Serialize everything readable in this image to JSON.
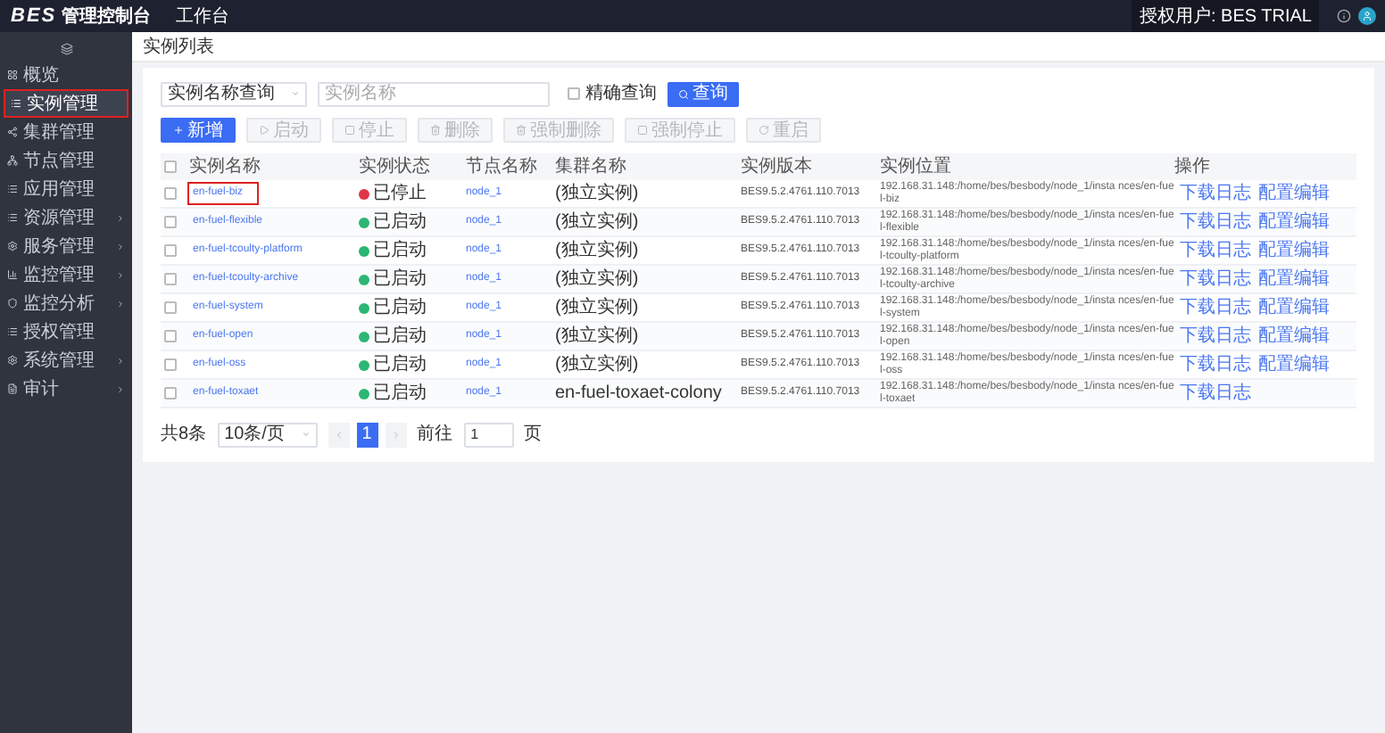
{
  "header": {
    "logo": "BES",
    "title": "管理控制台",
    "nav": "工作台",
    "user": "授权用户: BES TRIAL"
  },
  "sidebar": {
    "items": [
      {
        "label": "概览",
        "expandable": false,
        "selected": false
      },
      {
        "label": "实例管理",
        "expandable": false,
        "selected": true
      },
      {
        "label": "集群管理",
        "expandable": false,
        "selected": false
      },
      {
        "label": "节点管理",
        "expandable": false,
        "selected": false
      },
      {
        "label": "应用管理",
        "expandable": false,
        "selected": false
      },
      {
        "label": "资源管理",
        "expandable": true,
        "selected": false
      },
      {
        "label": "服务管理",
        "expandable": true,
        "selected": false
      },
      {
        "label": "监控管理",
        "expandable": true,
        "selected": false
      },
      {
        "label": "监控分析",
        "expandable": true,
        "selected": false
      },
      {
        "label": "授权管理",
        "expandable": false,
        "selected": false
      },
      {
        "label": "系统管理",
        "expandable": true,
        "selected": false
      },
      {
        "label": "审计",
        "expandable": true,
        "selected": false
      }
    ]
  },
  "breadcrumb": "实例列表",
  "filters": {
    "select": "实例名称查询",
    "search": {
      "placeholder": "实例名称"
    },
    "exact": {
      "label": "精确查询",
      "checked": false
    },
    "query": "查询"
  },
  "toolbar": [
    {
      "label": "新增",
      "disabled": false
    },
    {
      "label": "启动",
      "disabled": true
    },
    {
      "label": "停止",
      "disabled": true
    },
    {
      "label": "删除",
      "disabled": true
    },
    {
      "label": "强制删除",
      "disabled": true
    },
    {
      "label": "强制停止",
      "disabled": true
    },
    {
      "label": "重启",
      "disabled": true
    }
  ],
  "table": {
    "all_checked": false,
    "columns": [
      "实例名称",
      "实例状态",
      "节点名称",
      "集群名称",
      "实例版本",
      "实例位置",
      "操作"
    ],
    "rows": [
      {
        "checked": false,
        "name": "en-fuel-biz",
        "highlighted": true,
        "status": "已停止",
        "running": false,
        "node": "node_1",
        "cluster": "(独立实例)",
        "version": "BES9.5.2.4761.110.7013",
        "location": "192.168.31.148:/home/bes/besbody/node_1/insta nces/en-fuel-biz",
        "actions": [
          "下载日志",
          "配置编辑"
        ]
      },
      {
        "checked": false,
        "name": "en-fuel-flexible",
        "highlighted": false,
        "status": "已启动",
        "running": true,
        "node": "node_1",
        "cluster": "(独立实例)",
        "version": "BES9.5.2.4761.110.7013",
        "location": "192.168.31.148:/home/bes/besbody/node_1/insta nces/en-fuel-flexible",
        "actions": [
          "下载日志",
          "配置编辑"
        ]
      },
      {
        "checked": false,
        "name": "en-fuel-tcoulty-platform",
        "highlighted": false,
        "status": "已启动",
        "running": true,
        "node": "node_1",
        "cluster": "(独立实例)",
        "version": "BES9.5.2.4761.110.7013",
        "location": "192.168.31.148:/home/bes/besbody/node_1/insta nces/en-fuel-tcoulty-platform",
        "actions": [
          "下载日志",
          "配置编辑"
        ]
      },
      {
        "checked": false,
        "name": "en-fuel-tcoulty-archive",
        "highlighted": false,
        "status": "已启动",
        "running": true,
        "node": "node_1",
        "cluster": "(独立实例)",
        "version": "BES9.5.2.4761.110.7013",
        "location": "192.168.31.148:/home/bes/besbody/node_1/insta nces/en-fuel-tcoulty-archive",
        "actions": [
          "下载日志",
          "配置编辑"
        ]
      },
      {
        "checked": false,
        "name": "en-fuel-system",
        "highlighted": false,
        "status": "已启动",
        "running": true,
        "node": "node_1",
        "cluster": "(独立实例)",
        "version": "BES9.5.2.4761.110.7013",
        "location": "192.168.31.148:/home/bes/besbody/node_1/insta nces/en-fuel-system",
        "actions": [
          "下载日志",
          "配置编辑"
        ]
      },
      {
        "checked": false,
        "name": "en-fuel-open",
        "highlighted": false,
        "status": "已启动",
        "running": true,
        "node": "node_1",
        "cluster": "(独立实例)",
        "version": "BES9.5.2.4761.110.7013",
        "location": "192.168.31.148:/home/bes/besbody/node_1/insta nces/en-fuel-open",
        "actions": [
          "下载日志",
          "配置编辑"
        ]
      },
      {
        "checked": false,
        "name": "en-fuel-oss",
        "highlighted": false,
        "status": "已启动",
        "running": true,
        "node": "node_1",
        "cluster": "(独立实例)",
        "version": "BES9.5.2.4761.110.7013",
        "location": "192.168.31.148:/home/bes/besbody/node_1/insta nces/en-fuel-oss",
        "actions": [
          "下载日志",
          "配置编辑"
        ]
      },
      {
        "checked": false,
        "name": "en-fuel-toxaet",
        "highlighted": false,
        "status": "已启动",
        "running": true,
        "node": "node_1",
        "cluster": "en-fuel-toxaet-colony",
        "version": "BES9.5.2.4761.110.7013",
        "location": "192.168.31.148:/home/bes/besbody/node_1/insta nces/en-fuel-toxaet",
        "actions": [
          "下载日志"
        ]
      }
    ]
  },
  "pagination": {
    "total": "共8条",
    "size": "10条/页",
    "pages": [
      {
        "label": "1",
        "selected": true
      }
    ],
    "goto": "前往",
    "page": "1",
    "unit": "页"
  }
}
